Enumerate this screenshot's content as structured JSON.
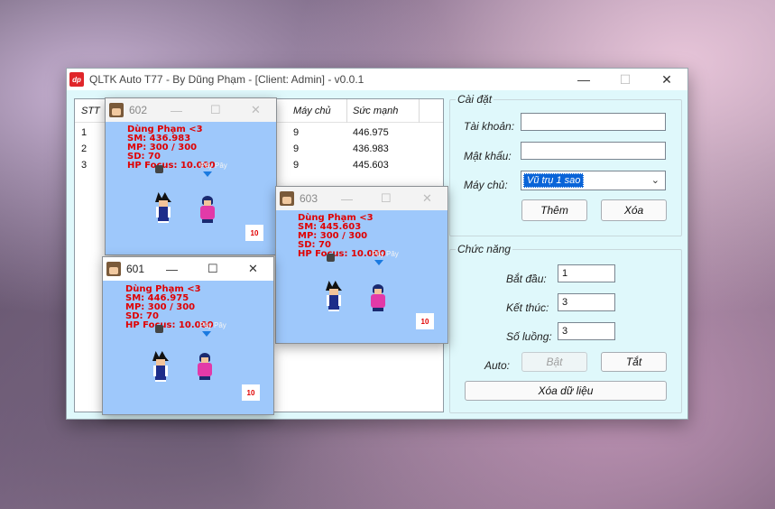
{
  "app": {
    "logo_text": "dp",
    "title": "QLTK Auto T77 - By Dũng Phạm - [Client: Admin] - v0.0.1"
  },
  "grid": {
    "headers": {
      "stt": "STT",
      "server": "Máy chủ",
      "power": "Sức mạnh"
    },
    "rows": [
      {
        "stt": "1",
        "server": "9",
        "power": "446.975"
      },
      {
        "stt": "2",
        "server": "9",
        "power": "436.983"
      },
      {
        "stt": "3",
        "server": "9",
        "power": "445.603"
      }
    ]
  },
  "settings": {
    "title": "Cài đặt",
    "account_label": "Tài khoản:",
    "account_value": "",
    "password_label": "Mật khẩu:",
    "password_value": "",
    "server_label": "Máy chủ:",
    "server_value": "Vũ trụ 1 sao",
    "add_button": "Thêm",
    "delete_button": "Xóa"
  },
  "functions": {
    "title": "Chức năng",
    "start_label": "Bắt đầu:",
    "start_value": "1",
    "end_label": "Kết thúc:",
    "end_value": "3",
    "threads_label": "Số luồng:",
    "threads_value": "3",
    "auto_label": "Auto:",
    "on_button": "Bật",
    "off_button": "Tắt",
    "clear_button": "Xóa dữ liệu"
  },
  "clients": {
    "w602": {
      "name": "602",
      "player": "Dùng Phạm <3",
      "sm": "SM: 436.983",
      "mp": "MP: 300 / 300",
      "sd": "SD: 70",
      "hp": "HP Focus: 10.000",
      "tag": "Pây Pây",
      "level": "10"
    },
    "w603": {
      "name": "603",
      "player": "Dùng Phạm <3",
      "sm": "SM: 445.603",
      "mp": "MP: 300 / 300",
      "sd": "SD: 70",
      "hp": "HP Focus: 10.000",
      "tag": "Pây Pây",
      "level": "10"
    },
    "w601": {
      "name": "601",
      "player": "Dùng Phạm <3",
      "sm": "SM: 446.975",
      "mp": "MP: 300 / 300",
      "sd": "SD: 70",
      "hp": "HP Focus: 10.000",
      "tag": "Pây Pây",
      "level": "10"
    }
  },
  "window_controls": {
    "minimize": "—",
    "maximize": "☐",
    "close": "✕"
  }
}
